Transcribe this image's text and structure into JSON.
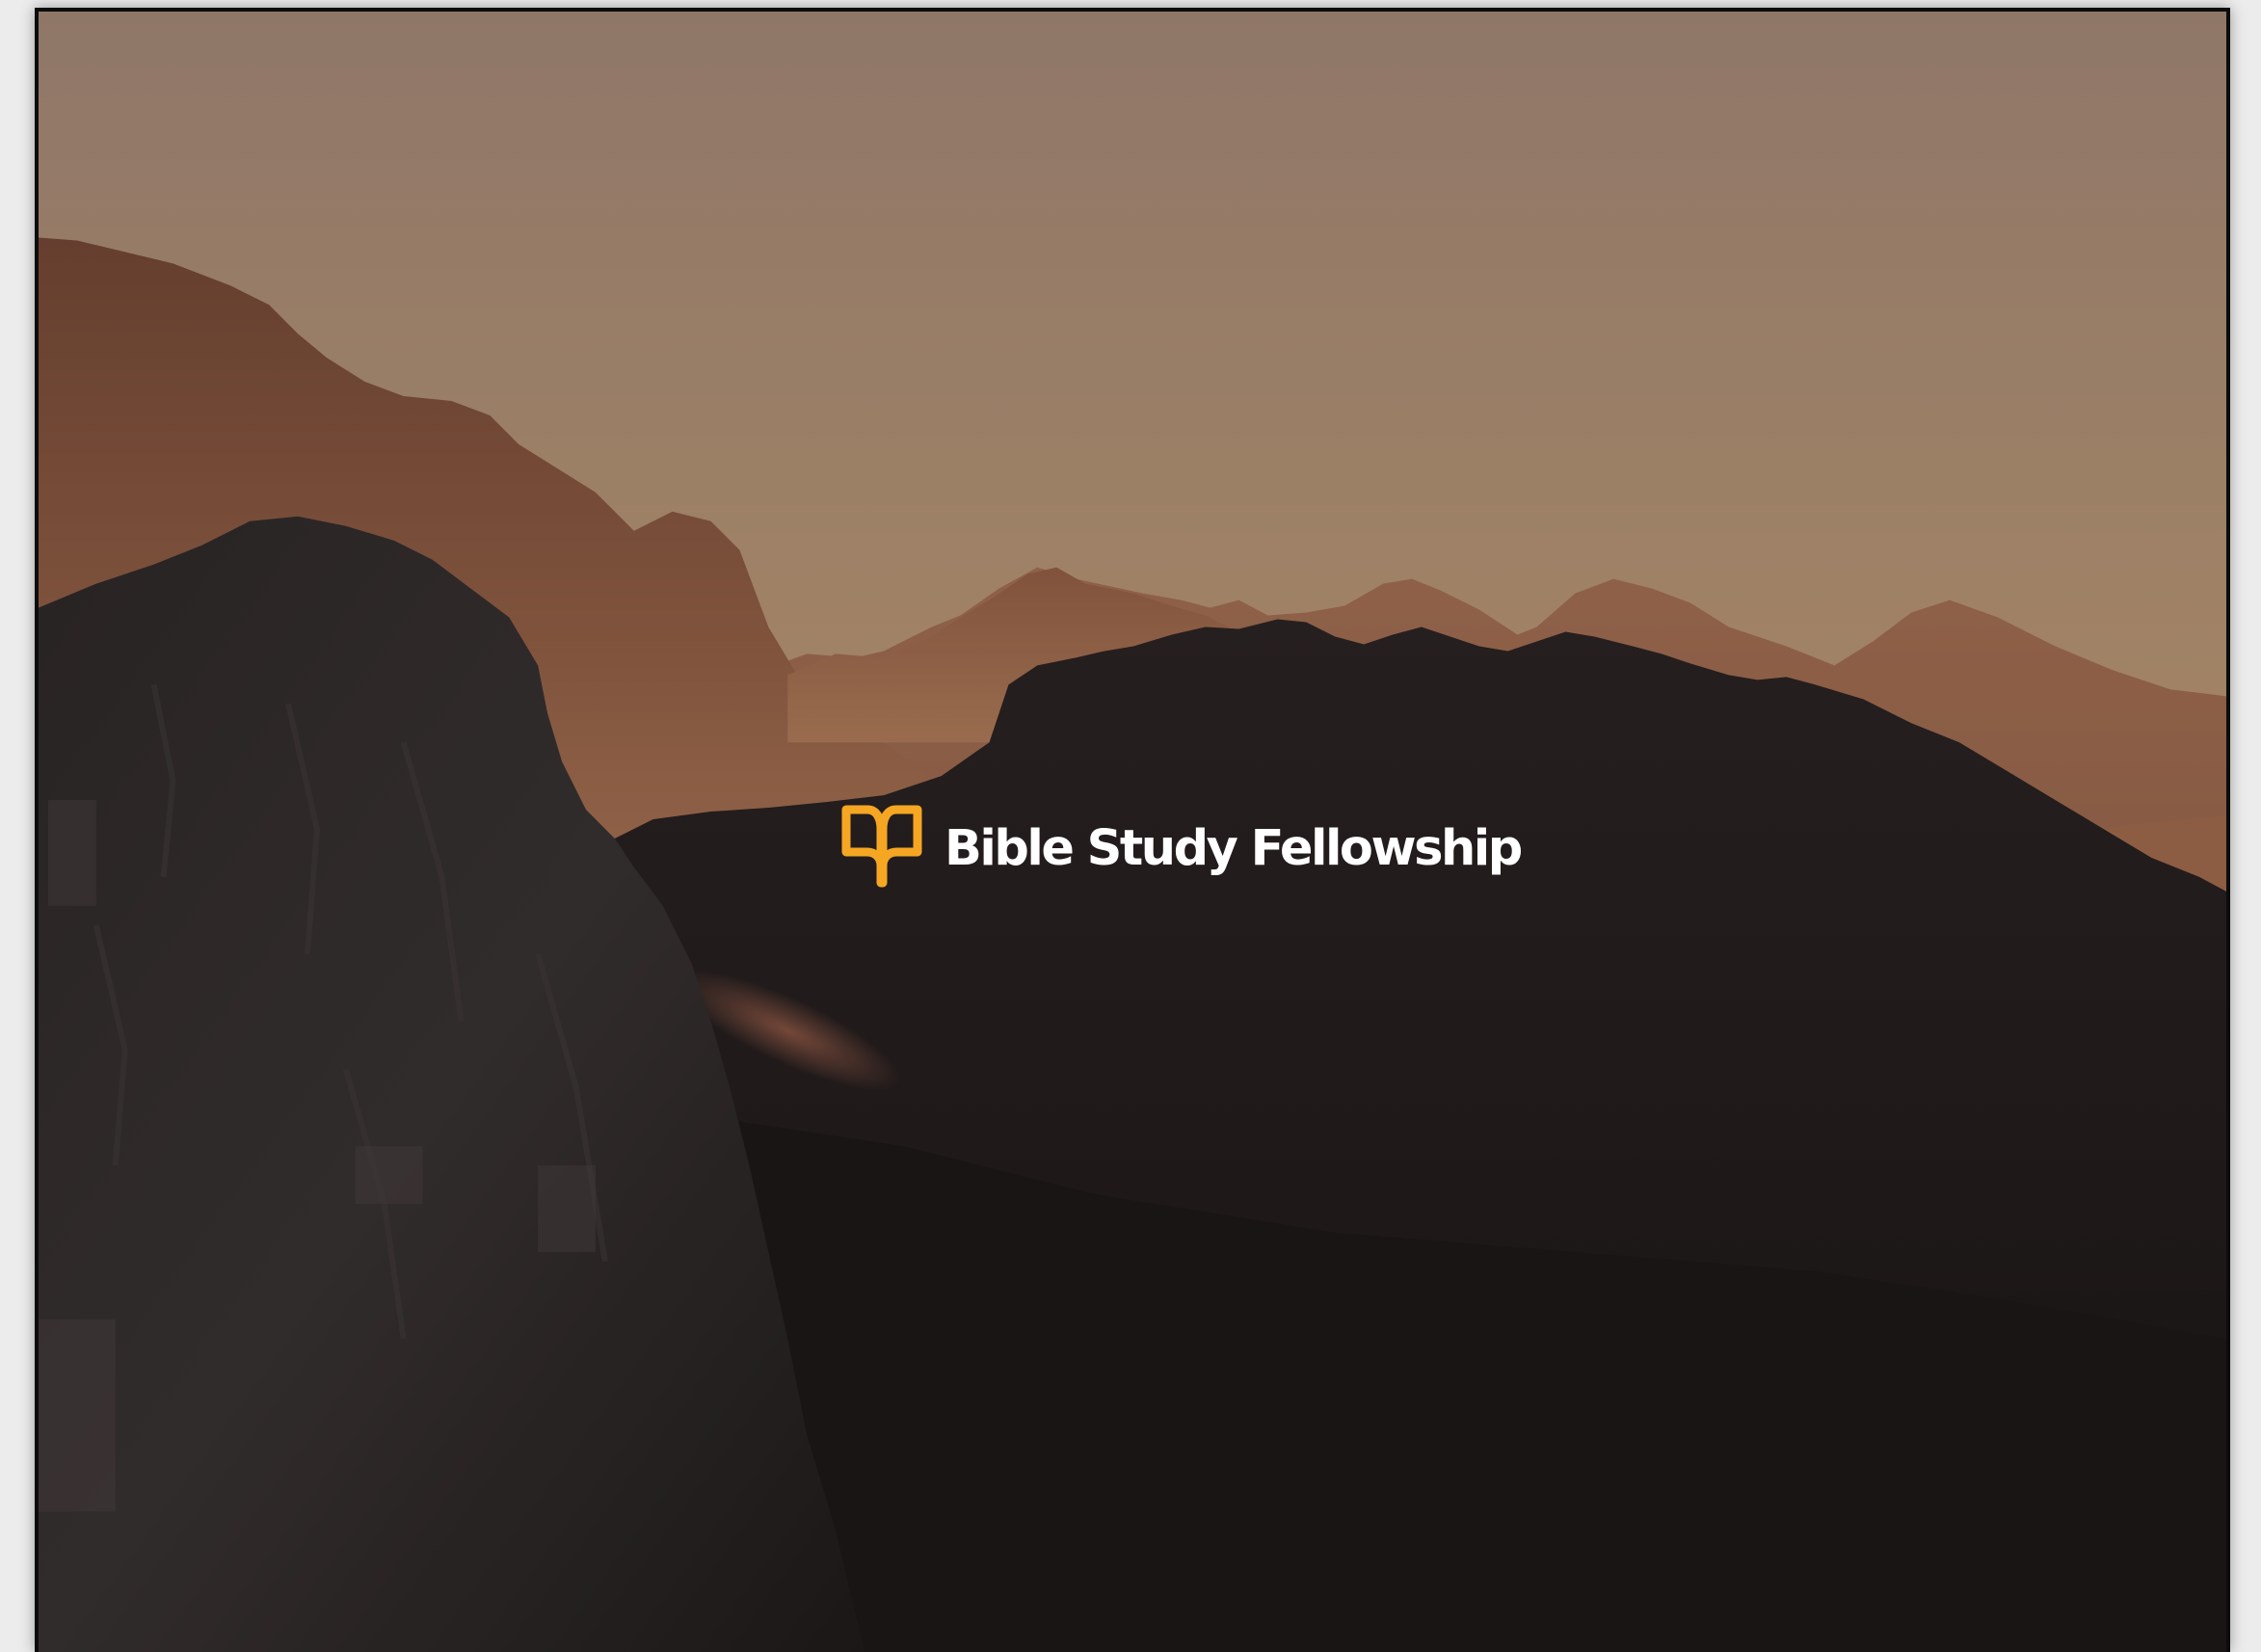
{
  "splash": {
    "brand_name": "Bible Study Fellowship",
    "logo_icon": "open-book-icon",
    "background": "mountain-silhouette-at-dusk"
  },
  "colors": {
    "logo_accent": "#F5A623",
    "wordmark": "#FFFFFF",
    "sky_top": "#9C8170",
    "sky_bottom": "#B8926A",
    "foreground": "#1F1A18"
  }
}
